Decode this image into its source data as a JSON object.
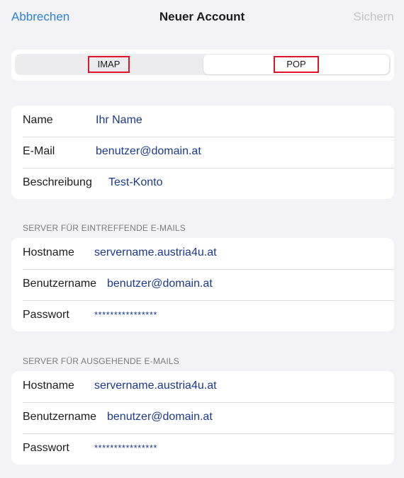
{
  "navbar": {
    "cancel_label": "Abbrechen",
    "title": "Neuer Account",
    "save_label": "Sichern"
  },
  "account_type": {
    "options": [
      "IMAP",
      "POP"
    ],
    "selected": "POP"
  },
  "account_info": [
    {
      "label": "Name",
      "value": "Ihr Name"
    },
    {
      "label": "E-Mail",
      "value": "benutzer@domain.at"
    },
    {
      "label": "Beschreibung",
      "value": "Test-Konto"
    }
  ],
  "incoming": {
    "header": "SERVER FÜR EINTREFFENDE E-MAILS",
    "rows": [
      {
        "label": "Hostname",
        "value": "servername.austria4u.at"
      },
      {
        "label": "Benutzername",
        "value": "benutzer@domain.at"
      },
      {
        "label": "Passwort",
        "value": "****************"
      }
    ]
  },
  "outgoing": {
    "header": "SERVER FÜR AUSGEHENDE E-MAILS",
    "rows": [
      {
        "label": "Hostname",
        "value": "servername.austria4u.at"
      },
      {
        "label": "Benutzername",
        "value": "benutzer@domain.at"
      },
      {
        "label": "Passwort",
        "value": "****************"
      }
    ]
  },
  "colors": {
    "accent": "#2f7fdc",
    "value_text": "#1a3a8f",
    "highlight_border": "#e0152a",
    "disabled": "#c4c4c7",
    "background": "#f2f2f7"
  }
}
